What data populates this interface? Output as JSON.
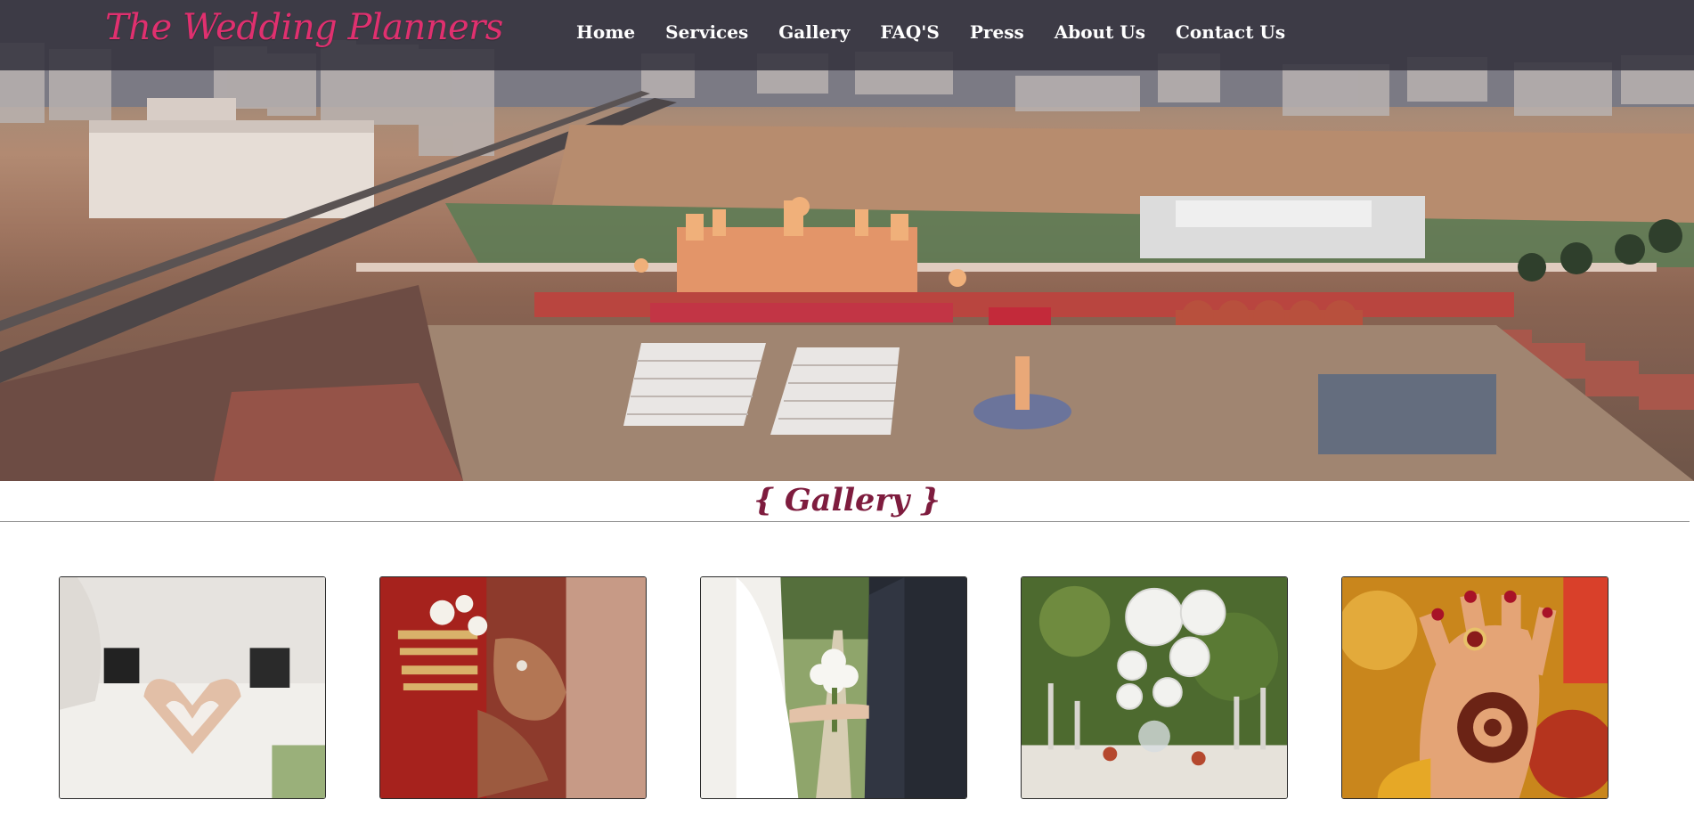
{
  "brand": {
    "logo_text": "The Wedding Planners",
    "logo_color": "#e0306f"
  },
  "nav": {
    "items": [
      "Home",
      "Services",
      "Gallery",
      "FAQ'S",
      "Press",
      "About Us",
      "Contact Us"
    ]
  },
  "hero": {
    "image": "aerial-wedding-venue-photo"
  },
  "gallery": {
    "title": "{ Gallery }",
    "title_color": "#7e1c3e",
    "photos": [
      "bride-groom-heart-hands-photo",
      "bridal-mehndi-bangles-hands-photo",
      "bride-groom-holding-hands-bouquet-photo",
      "outdoor-table-setting-hanging-lanterns-photo",
      "henna-hand-rings-photo"
    ]
  }
}
